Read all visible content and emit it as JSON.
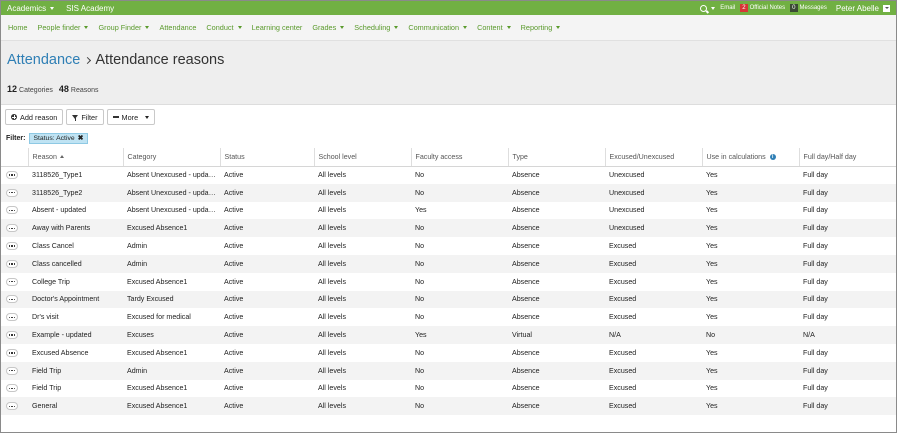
{
  "topbar": {
    "app_menu": "Academics",
    "school": "SIS Academy",
    "email": "Email",
    "official_notes_count": "2",
    "official_notes": "Official Notes",
    "messages_count": "0",
    "messages": "Messages",
    "user": "Peter Abelle",
    "color": "#71b043"
  },
  "nav": [
    {
      "label": "Home",
      "dropdown": false
    },
    {
      "label": "People finder",
      "dropdown": true
    },
    {
      "label": "Group Finder",
      "dropdown": true
    },
    {
      "label": "Attendance",
      "dropdown": false
    },
    {
      "label": "Conduct",
      "dropdown": true
    },
    {
      "label": "Learning center",
      "dropdown": false
    },
    {
      "label": "Grades",
      "dropdown": true
    },
    {
      "label": "Scheduling",
      "dropdown": true
    },
    {
      "label": "Communication",
      "dropdown": true
    },
    {
      "label": "Content",
      "dropdown": true
    },
    {
      "label": "Reporting",
      "dropdown": true
    }
  ],
  "header": {
    "breadcrumb": "Attendance",
    "title": "Attendance reasons",
    "categories_count": "12",
    "categories_label": "Categories",
    "reasons_count": "48",
    "reasons_label": "Reasons"
  },
  "toolbar": {
    "add_label": "Add reason",
    "filter_label": "Filter",
    "more_label": "More"
  },
  "filter": {
    "label": "Filter:",
    "chip": "Status: Active"
  },
  "table": {
    "columns": [
      "Reason",
      "Category",
      "Status",
      "School level",
      "Faculty access",
      "Type",
      "Excused/Unexcused",
      "Use in calculations",
      "Full day/Half day"
    ],
    "rows": [
      [
        "3118526_Type1",
        "Absent Unexcused - updated",
        "Active",
        "All levels",
        "No",
        "Absence",
        "Unexcused",
        "Yes",
        "Full day"
      ],
      [
        "3118526_Type2",
        "Absent Unexcused - updated",
        "Active",
        "All levels",
        "No",
        "Absence",
        "Unexcused",
        "Yes",
        "Full day"
      ],
      [
        "Absent - updated",
        "Absent Unexcused - updated",
        "Active",
        "All levels",
        "Yes",
        "Absence",
        "Unexcused",
        "Yes",
        "Full day"
      ],
      [
        "Away with Parents",
        "Excused Absence1",
        "Active",
        "All levels",
        "No",
        "Absence",
        "Unexcused",
        "Yes",
        "Full day"
      ],
      [
        "Class Cancel",
        "Admin",
        "Active",
        "All levels",
        "No",
        "Absence",
        "Excused",
        "Yes",
        "Full day"
      ],
      [
        "Class cancelled",
        "Admin",
        "Active",
        "All levels",
        "No",
        "Absence",
        "Excused",
        "Yes",
        "Full day"
      ],
      [
        "College Trip",
        "Excused Absence1",
        "Active",
        "All levels",
        "No",
        "Absence",
        "Excused",
        "Yes",
        "Full day"
      ],
      [
        "Doctor's Appointment",
        "Tardy Excused",
        "Active",
        "All levels",
        "No",
        "Absence",
        "Excused",
        "Yes",
        "Full day"
      ],
      [
        "Dr's visit",
        "Excused for medical",
        "Active",
        "All levels",
        "No",
        "Absence",
        "Excused",
        "Yes",
        "Full day"
      ],
      [
        "Example - updated",
        "Excuses",
        "Active",
        "All levels",
        "Yes",
        "Virtual",
        "N/A",
        "No",
        "N/A"
      ],
      [
        "Excused Absence",
        "Excused Absence1",
        "Active",
        "All levels",
        "No",
        "Absence",
        "Excused",
        "Yes",
        "Full day"
      ],
      [
        "Field Trip",
        "Admin",
        "Active",
        "All levels",
        "No",
        "Absence",
        "Excused",
        "Yes",
        "Full day"
      ],
      [
        "Field Trip",
        "Excused Absence1",
        "Active",
        "All levels",
        "No",
        "Absence",
        "Excused",
        "Yes",
        "Full day"
      ],
      [
        "General",
        "Excused Absence1",
        "Active",
        "All levels",
        "No",
        "Absence",
        "Excused",
        "Yes",
        "Full day"
      ]
    ]
  }
}
